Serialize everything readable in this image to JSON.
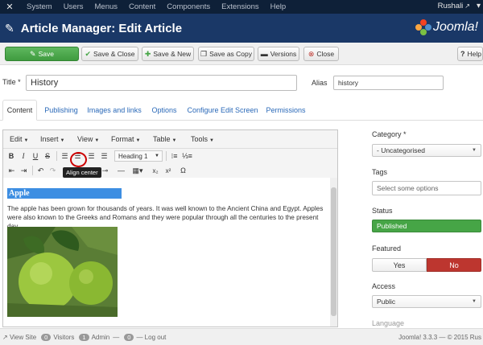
{
  "topnav": {
    "menu": [
      "System",
      "Users",
      "Menus",
      "Content",
      "Components",
      "Extensions",
      "Help"
    ],
    "user": "Rushali"
  },
  "header": {
    "title": "Article Manager: Edit Article",
    "brand": "Joomla!"
  },
  "toolbar": {
    "save": "Save",
    "save_close": "Save & Close",
    "save_new": "Save & New",
    "save_copy": "Save as Copy",
    "versions": "Versions",
    "close": "Close",
    "help": "Help"
  },
  "form": {
    "title_label": "Title *",
    "title_value": "History",
    "alias_label": "Alias",
    "alias_value": "history"
  },
  "tabs": [
    "Content",
    "Publishing",
    "Images and links",
    "Options",
    "Configure Edit Screen",
    "Permissions"
  ],
  "editor": {
    "menus": [
      "Edit",
      "Insert",
      "View",
      "Format",
      "Table",
      "Tools"
    ],
    "format_select": "Heading 1",
    "tooltip": "Align center",
    "heading": "Apple",
    "paragraph": "The apple has been grown for thousands of years. It was well known to the Ancient China and Egypt. Apples were also known to the Greeks and Romans and they were popular through all the centuries to the present day."
  },
  "sidebar": {
    "category_label": "Category *",
    "category_value": "- Uncategorised",
    "tags_label": "Tags",
    "tags_placeholder": "Select some options",
    "status_label": "Status",
    "status_value": "Published",
    "featured_label": "Featured",
    "featured_yes": "Yes",
    "featured_no": "No",
    "access_label": "Access",
    "access_value": "Public",
    "language_label": "Language"
  },
  "footer": {
    "view_site": "View Site",
    "visitors_count": "0",
    "visitors_label": "Visitors",
    "admin_count": "1",
    "admin_label": "Admin",
    "logout_count": "0",
    "logout_label": "Log out",
    "version": "Joomla! 3.3.3 — © 2015 Rus"
  },
  "colors": {
    "topnav_bg": "#0e2038",
    "header_bg": "#1a3867",
    "save_green": "#46a546",
    "status_green": "#46a546",
    "no_red": "#bd362f",
    "highlight_blue": "#3d8ee2",
    "tooltip_circle": "#cc0000"
  }
}
